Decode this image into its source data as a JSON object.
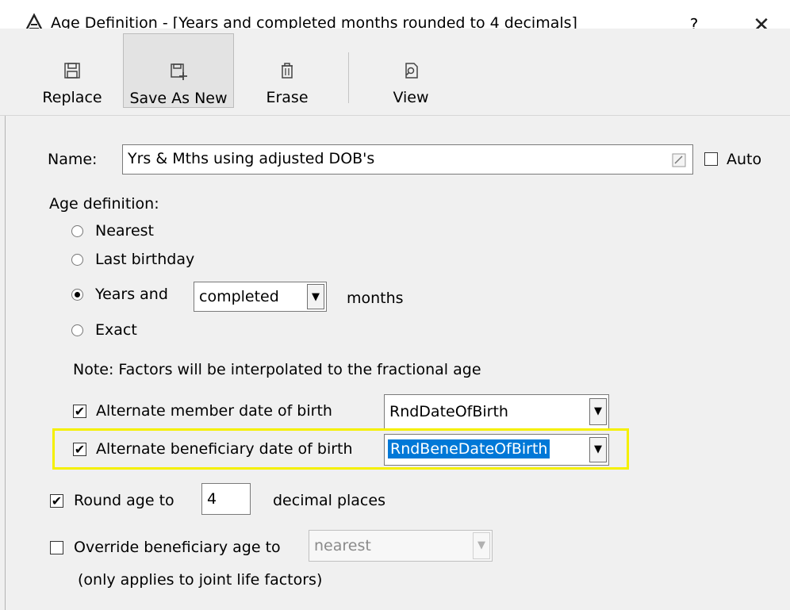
{
  "window": {
    "title": "Age Definition - [Years and completed months rounded to 4 decimals]",
    "help_label": "?",
    "close_label": "✕"
  },
  "toolbar": {
    "replace_label": "Replace",
    "save_as_new_label": "Save As New",
    "erase_label": "Erase",
    "view_label": "View"
  },
  "form": {
    "name_label": "Name:",
    "name_value": "Yrs & Mths using adjusted DOB's",
    "auto_label": "Auto",
    "auto_checked": false,
    "age_definition_label": "Age definition:",
    "radio_nearest": "Nearest",
    "radio_last_birthday": "Last birthday",
    "radio_years_and": "Years and",
    "months_mode_value": "completed",
    "months_label": "months",
    "radio_exact": "Exact",
    "selected_age_option": "Years and",
    "note": "Note: Factors will be interpolated to the fractional age",
    "alt_member_label": "Alternate member date of birth",
    "alt_member_value": "RndDateOfBirth",
    "alt_member_checked": true,
    "alt_bene_label": "Alternate beneficiary date of birth",
    "alt_bene_value": "RndBeneDateOfBirth",
    "alt_bene_checked": true,
    "round_label": "Round age to",
    "round_value": "4",
    "round_suffix": "decimal places",
    "round_checked": true,
    "override_label": "Override beneficiary age to",
    "override_value": "nearest",
    "override_checked": false,
    "override_note": "(only applies to joint life factors)"
  },
  "colors": {
    "highlight": "#f5f000",
    "selection": "#0078d7"
  }
}
